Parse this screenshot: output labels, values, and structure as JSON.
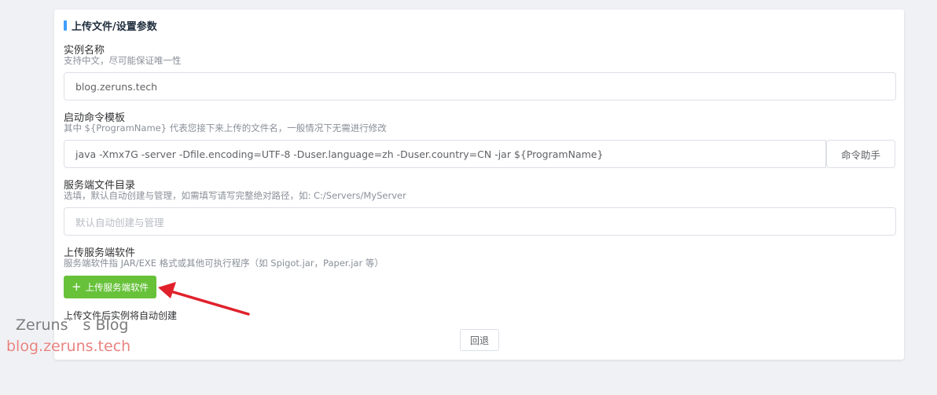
{
  "card": {
    "title": "上传文件/设置参数"
  },
  "instance_name": {
    "label": "实例名称",
    "desc": "支持中文，尽可能保证唯一性",
    "value": "blog.zeruns.tech"
  },
  "start_command": {
    "label": "启动命令模板",
    "desc": "其中 ${ProgramName} 代表您接下来上传的文件名，一般情况下无需进行修改",
    "value": "java -Xmx7G -server -Dfile.encoding=UTF-8 -Duser.language=zh -Duser.country=CN -jar ${ProgramName}",
    "helper_button": "命令助手"
  },
  "server_dir": {
    "label": "服务端文件目录",
    "desc": "选填，默认自动创建与管理，如需填写请写完整绝对路径，如: C:/Servers/MyServer",
    "placeholder": "默认自动创建与管理"
  },
  "upload": {
    "label": "上传服务端软件",
    "desc": "服务端软件指 JAR/EXE 格式或其他可执行程序（如 Spigot.jar，Paper.jar 等）",
    "button": "上传服务端软件",
    "hint": "上传文件后实例将自动创建"
  },
  "back_button": "回退",
  "watermark": {
    "line1": "Zeruns゛s Blog",
    "line2": "blog.zeruns.tech",
    "color1": "#7b7b7b",
    "color2": "#e8837f"
  },
  "colors": {
    "accent": "#409eff",
    "success": "#67c23a",
    "arrow": "#e0212b"
  }
}
